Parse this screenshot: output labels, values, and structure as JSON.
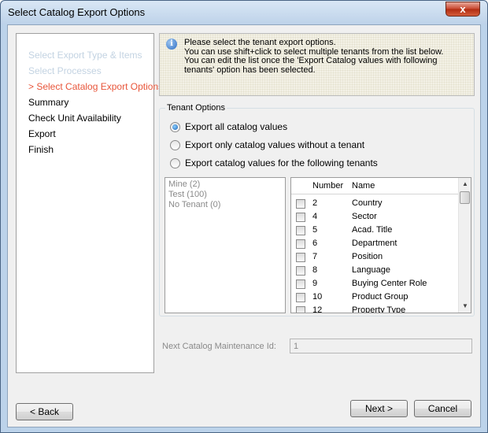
{
  "window": {
    "title": "Select Catalog Export Options",
    "close_label": "x"
  },
  "steps": [
    {
      "label": "Select Export Type & Items",
      "state": "disabled"
    },
    {
      "label": "Select Processes",
      "state": "disabled"
    },
    {
      "label": "> Select Catalog Export Options",
      "state": "active"
    },
    {
      "label": "Summary",
      "state": "normal"
    },
    {
      "label": "Check Unit Availability",
      "state": "normal"
    },
    {
      "label": "Export",
      "state": "normal"
    },
    {
      "label": "Finish",
      "state": "normal"
    }
  ],
  "info": {
    "icon": "info-icon",
    "icon_glyph": "i",
    "lines": [
      "Please select the tenant export options.",
      "You can use shift+click to select multiple tenants from the list below.",
      "You can edit the list once the 'Export Catalog values with following",
      "tenants' option has been selected."
    ]
  },
  "tenant_options": {
    "title": "Tenant Options",
    "radios": [
      {
        "label": "Export all catalog values",
        "checked": true
      },
      {
        "label": "Export only catalog values without a tenant",
        "checked": false
      },
      {
        "label": "Export catalog values for the following tenants",
        "checked": false
      }
    ],
    "tenants": [
      "Mine (2)",
      "Test (100)",
      "No Tenant (0)"
    ],
    "grid": {
      "columns": [
        "Number",
        "Name"
      ],
      "rows": [
        {
          "number": "2",
          "name": "Country"
        },
        {
          "number": "4",
          "name": "Sector"
        },
        {
          "number": "5",
          "name": "Acad. Title"
        },
        {
          "number": "6",
          "name": "Department"
        },
        {
          "number": "7",
          "name": "Position"
        },
        {
          "number": "8",
          "name": "Language"
        },
        {
          "number": "9",
          "name": "Buying Center Role"
        },
        {
          "number": "10",
          "name": "Product Group"
        },
        {
          "number": "12",
          "name": "Property Type"
        }
      ]
    }
  },
  "maintenance": {
    "label": "Next Catalog Maintenance Id:",
    "value": "1"
  },
  "buttons": {
    "back": "< Back",
    "next": "Next >",
    "cancel": "Cancel"
  },
  "colors": {
    "active_step": "#e8553a",
    "disabled_step": "#c3d3e2",
    "title_bar": "#bdd2e9"
  }
}
